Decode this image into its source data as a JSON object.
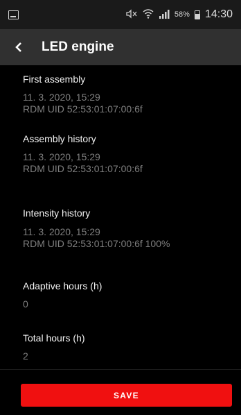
{
  "statusbar": {
    "battery_percent": "58%",
    "time": "14:30",
    "icons": [
      "gallery-icon",
      "mute-icon",
      "wifi-icon",
      "signal-icon",
      "battery-icon"
    ]
  },
  "toolbar": {
    "title": "LED engine"
  },
  "fields": {
    "first_assembly": {
      "label": "First assembly",
      "line1": "11. 3. 2020, 15:29",
      "line2": "RDM UID 52:53:01:07:00:6f"
    },
    "assembly_history": {
      "label": "Assembly history",
      "line1": "11. 3. 2020, 15:29",
      "line2": "RDM UID 52:53:01:07:00:6f"
    },
    "intensity_history": {
      "label": "Intensity history",
      "line1": "11. 3. 2020, 15:29",
      "line2": "RDM UID 52:53:01:07:00:6f 100%"
    },
    "adaptive_hours": {
      "label": "Adaptive hours (h)",
      "value": "0"
    },
    "total_hours": {
      "label": "Total hours (h)",
      "value": "2"
    }
  },
  "footer": {
    "save_label": "SAVE"
  },
  "colors": {
    "accent": "#f01010",
    "toolbar": "#303030",
    "background": "#000000",
    "secondary_text": "#7f7f7f"
  }
}
